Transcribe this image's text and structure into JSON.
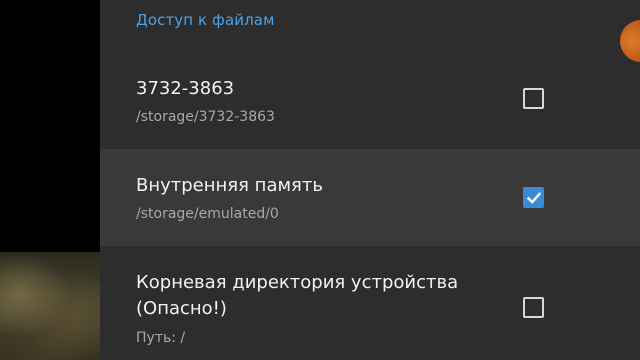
{
  "section": {
    "header": "Доступ к файлам"
  },
  "items": [
    {
      "title": "3732-3863",
      "subtitle": "/storage/3732-3863",
      "checked": false
    },
    {
      "title": "Внутренняя память",
      "subtitle": "/storage/emulated/0",
      "checked": true
    },
    {
      "title_line1": "Корневая директория устройства",
      "title_line2": "(Опасно!)",
      "subtitle": "Путь: /",
      "checked": false
    }
  ],
  "colors": {
    "accent": "#4aa3e8",
    "checkbox_checked": "#3b8ad8",
    "panel_background": "#2d2d2d",
    "highlight_row": "#393939"
  },
  "icons": {
    "checkmark": "checkmark-icon"
  }
}
